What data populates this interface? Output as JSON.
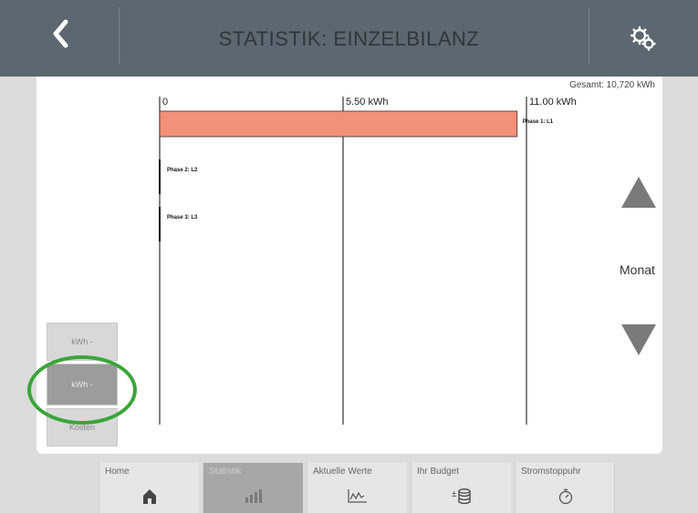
{
  "header": {
    "title": "STATISTIK: EINZELBILANZ",
    "back_icon": "chevron-left-icon",
    "settings_icon": "gears-icon"
  },
  "summary": {
    "total": "Gesamt: 10,720 kWh"
  },
  "chart_data": {
    "type": "bar",
    "orientation": "horizontal",
    "categories": [
      "Phase 1: L1",
      "Phase 2: L2",
      "Phase 3: L3"
    ],
    "values": [
      10.72,
      0,
      0
    ],
    "xlim": [
      0,
      11
    ],
    "tick_labels": [
      "0",
      "5.50 kWh",
      "11.00 kWh"
    ],
    "colors": {
      "bar": "#f39079"
    }
  },
  "side_buttons": [
    {
      "label": "kWh -"
    },
    {
      "label": "kWh -"
    },
    {
      "label": "Kosten"
    }
  ],
  "period": {
    "label": "Monat",
    "up_icon": "triangle-up-icon",
    "down_icon": "triangle-down-icon"
  },
  "tabs": [
    {
      "label": "Home",
      "icon": "home-icon"
    },
    {
      "label": "Statistik",
      "icon": "bar-chart-icon"
    },
    {
      "label": "Aktuelle Werte",
      "icon": "line-chart-icon"
    },
    {
      "label": "Ihr Budget",
      "icon": "coins-icon"
    },
    {
      "label": "Stromstoppuhr",
      "icon": "stopwatch-icon"
    }
  ]
}
